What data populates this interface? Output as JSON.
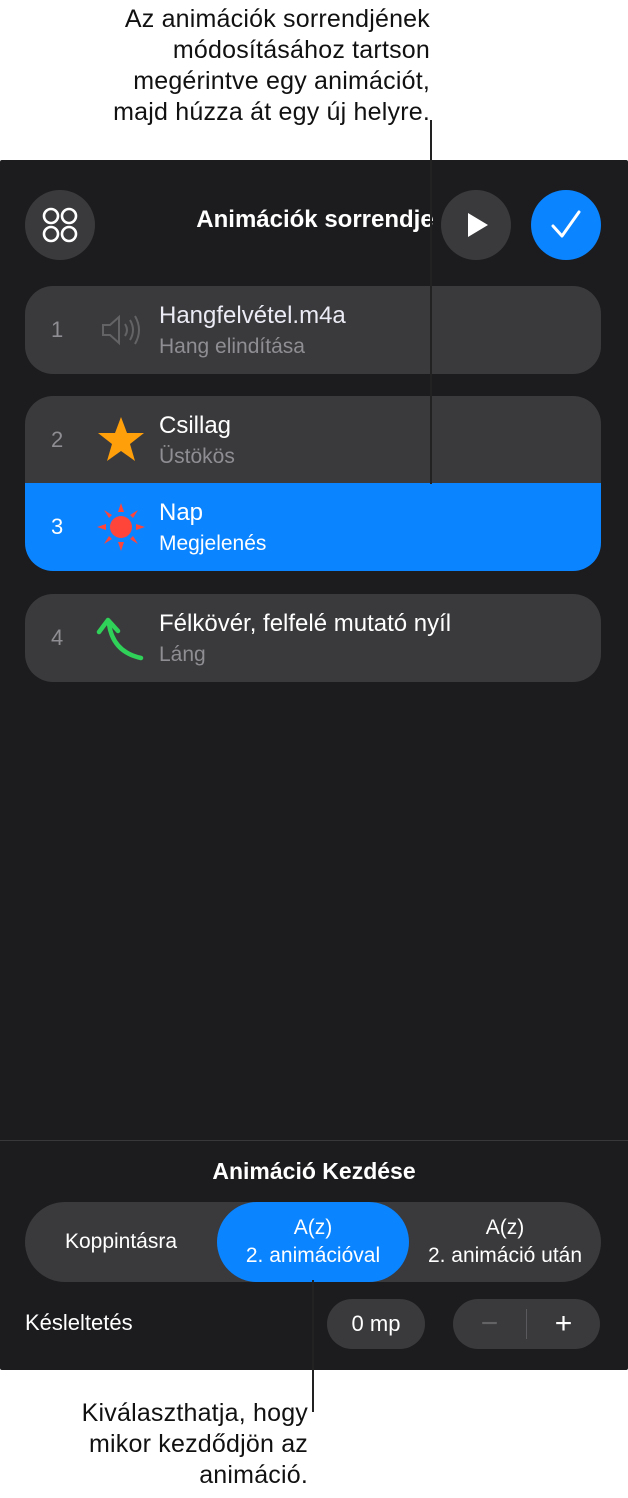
{
  "callouts": {
    "top": [
      "Az animációk sorrendjének",
      "módosításához tartson",
      "megérintve egy animációt,",
      "majd húzza át egy új helyre."
    ],
    "bottom": [
      "Kiválaszthatja, hogy",
      "mikor kezdődjön az",
      "animáció."
    ]
  },
  "header": {
    "title": "Animációk sorrendje",
    "icons": {
      "left": "shapes-grid-icon",
      "play": "play-icon",
      "done": "checkmark-icon"
    }
  },
  "animations": [
    {
      "number": "1",
      "title": "Hangfelvétel.m4a",
      "subtitle": "Hang elindítása",
      "icon": "speaker-icon"
    },
    {
      "number": "2",
      "title": "Csillag",
      "subtitle": "Üstökös",
      "icon": "star-icon"
    },
    {
      "number": "3",
      "title": "Nap",
      "subtitle": "Megjelenés",
      "icon": "sun-icon",
      "selected": true
    },
    {
      "number": "4",
      "title": "Félkövér, felfelé mutató nyíl",
      "subtitle": "Láng",
      "icon": "curved-arrow-icon"
    }
  ],
  "start": {
    "title": "Animáció Kezdése",
    "options": [
      {
        "line1": "Koppintásra"
      },
      {
        "line1": "A(z)",
        "line2": "2. animációval",
        "selected": true
      },
      {
        "line1": "A(z)",
        "line2": "2. animáció után"
      }
    ]
  },
  "delay": {
    "label": "Késleltetés",
    "value": "0 mp",
    "decrement": "−",
    "increment": "+"
  },
  "colors": {
    "accent": "#0a84ff",
    "panel": "#1c1c1e",
    "row": "#3a3a3c",
    "star": "#ff9f0a",
    "sun": "#ff453a",
    "arrow": "#30d158"
  }
}
